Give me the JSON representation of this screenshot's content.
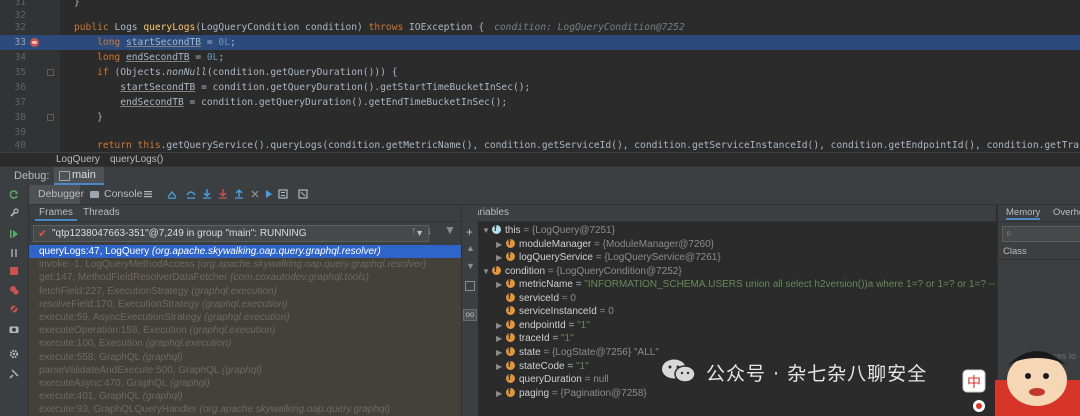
{
  "editor": {
    "lines": [
      {
        "num": "31"
      },
      {
        "num": "32"
      },
      {
        "num": "33"
      },
      {
        "num": "34"
      },
      {
        "num": "35"
      },
      {
        "num": "36"
      },
      {
        "num": "37"
      },
      {
        "num": "38"
      },
      {
        "num": "39"
      },
      {
        "num": "40"
      }
    ],
    "hint": "condition: LogQueryCondition@7252",
    "line41": "return this.getQueryService().queryLogs(condition.getMetricName(), condition.getServiceId(), condition.getServiceInstanceId(), condition.getEndpointId(), condition.getTraceId(), cond"
  },
  "breadcrumb": {
    "class_name": "LogQuery",
    "method_name": "queryLogs()"
  },
  "debug": {
    "label": "Debug:",
    "main_tab": "main",
    "toolbar": {
      "debugger": "Debugger",
      "console": "Console"
    },
    "subtabs": {
      "frames": "Frames",
      "threads": "Threads"
    },
    "thread_selector": "\"qtp1238047663-351\"@7,249 in group \"main\": RUNNING",
    "frames": [
      {
        "method": "queryLogs:47, LogQuery",
        "pkg": "(org.apache.skywalking.oap.query.graphql.resolver)"
      },
      {
        "method": "invoke:-1, LogQueryMethodAccess",
        "pkg": "(org.apache.skywalking.oap.query.graphql.resolver)"
      },
      {
        "method": "get:147, MethodFieldResolverDataFetcher",
        "pkg": "(com.coxautodev.graphql.tools)"
      },
      {
        "method": "fetchField:227, ExecutionStrategy",
        "pkg": "(graphql.execution)"
      },
      {
        "method": "resolveField:170, ExecutionStrategy",
        "pkg": "(graphql.execution)"
      },
      {
        "method": "execute:59, AsyncExecutionStrategy",
        "pkg": "(graphql.execution)"
      },
      {
        "method": "executeOperation:158, Execution",
        "pkg": "(graphql.execution)"
      },
      {
        "method": "execute:100, Execution",
        "pkg": "(graphql.execution)"
      },
      {
        "method": "execute:558, GraphQL",
        "pkg": "(graphql)"
      },
      {
        "method": "parseValidateAndExecute:500, GraphQL",
        "pkg": "(graphql)"
      },
      {
        "method": "executeAsync:470, GraphQL",
        "pkg": "(graphql)"
      },
      {
        "method": "execute:401, GraphQL",
        "pkg": "(graphql)"
      },
      {
        "method": "execute:93, GraphQLQueryHandler",
        "pkg": "(org.apache.skywalking.oap.query.graphql)"
      }
    ],
    "variables_title": "Variables",
    "variables": [
      {
        "name": "this",
        "value": "= {LogQuery@7251}"
      },
      {
        "name": "moduleManager",
        "value": "= {ModuleManager@7260}"
      },
      {
        "name": "logQueryService",
        "value": "= {LogQueryService@7261}"
      },
      {
        "name": "condition",
        "value": "= {LogQueryCondition@7252}"
      },
      {
        "name": "metricName",
        "eq": "=",
        "value": "\"INFORMATION_SCHEMA.USERS union all select h2version())a where 1=? or 1=? or 1=? --\""
      },
      {
        "name": "serviceId",
        "value": "= 0"
      },
      {
        "name": "serviceInstanceId",
        "value": "= 0"
      },
      {
        "name": "endpointId",
        "eq": "=",
        "value": "\"1\""
      },
      {
        "name": "traceId",
        "eq": "=",
        "value": "\"1\""
      },
      {
        "name": "state",
        "value": "= {LogState@7256} \"ALL\""
      },
      {
        "name": "stateCode",
        "eq": "=",
        "value": "\"1\""
      },
      {
        "name": "queryDuration",
        "value": "= null"
      },
      {
        "name": "paging",
        "value": "= {Pagination@7258}"
      }
    ],
    "memory": {
      "tab1": "Memory",
      "tab2": "Overhe",
      "column": "Class",
      "hint": "sses lo"
    }
  },
  "watermark": {
    "text": "公众号 · 杂七杂八聊安全",
    "avatar_text": "中"
  },
  "colors": {
    "highlight": "#2d4a7c",
    "selection": "#2f65ca",
    "keyword": "#cc7832",
    "string": "#6a8759",
    "method": "#ffc66d",
    "number": "#6897bb"
  }
}
